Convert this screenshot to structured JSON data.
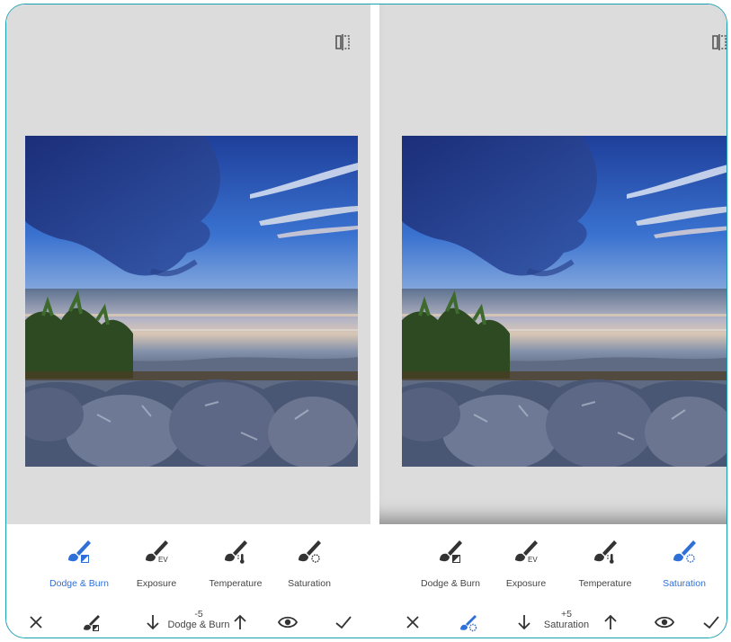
{
  "panels": [
    {
      "tools": [
        {
          "label": "Dodge & Burn",
          "icon": "brush-dodge-burn-icon",
          "active": true
        },
        {
          "label": "Exposure",
          "icon": "brush-exposure-icon",
          "active": false
        },
        {
          "label": "Temperature",
          "icon": "brush-temperature-icon",
          "active": false
        },
        {
          "label": "Saturation",
          "icon": "brush-saturation-icon",
          "active": false
        }
      ],
      "adjustment": {
        "value": "-5",
        "name": "Dodge & Burn"
      }
    },
    {
      "tools": [
        {
          "label": "Dodge & Burn",
          "icon": "brush-dodge-burn-icon",
          "active": false
        },
        {
          "label": "Exposure",
          "icon": "brush-exposure-icon",
          "active": false
        },
        {
          "label": "Temperature",
          "icon": "brush-temperature-icon",
          "active": false
        },
        {
          "label": "Saturation",
          "icon": "brush-saturation-icon",
          "active": true
        }
      ],
      "adjustment": {
        "value": "+5",
        "name": "Saturation"
      }
    }
  ],
  "icons": {
    "close": "close-icon",
    "brush": "brush-icon",
    "decrease": "arrow-down-icon",
    "increase": "arrow-up-icon",
    "view": "eye-icon",
    "apply": "checkmark-icon",
    "compare": "compare-icon"
  },
  "colors": {
    "accent": "#2f6fd8",
    "icon": "#333333",
    "canvas": "#dcdcdc",
    "frame": "#19a0b0"
  }
}
